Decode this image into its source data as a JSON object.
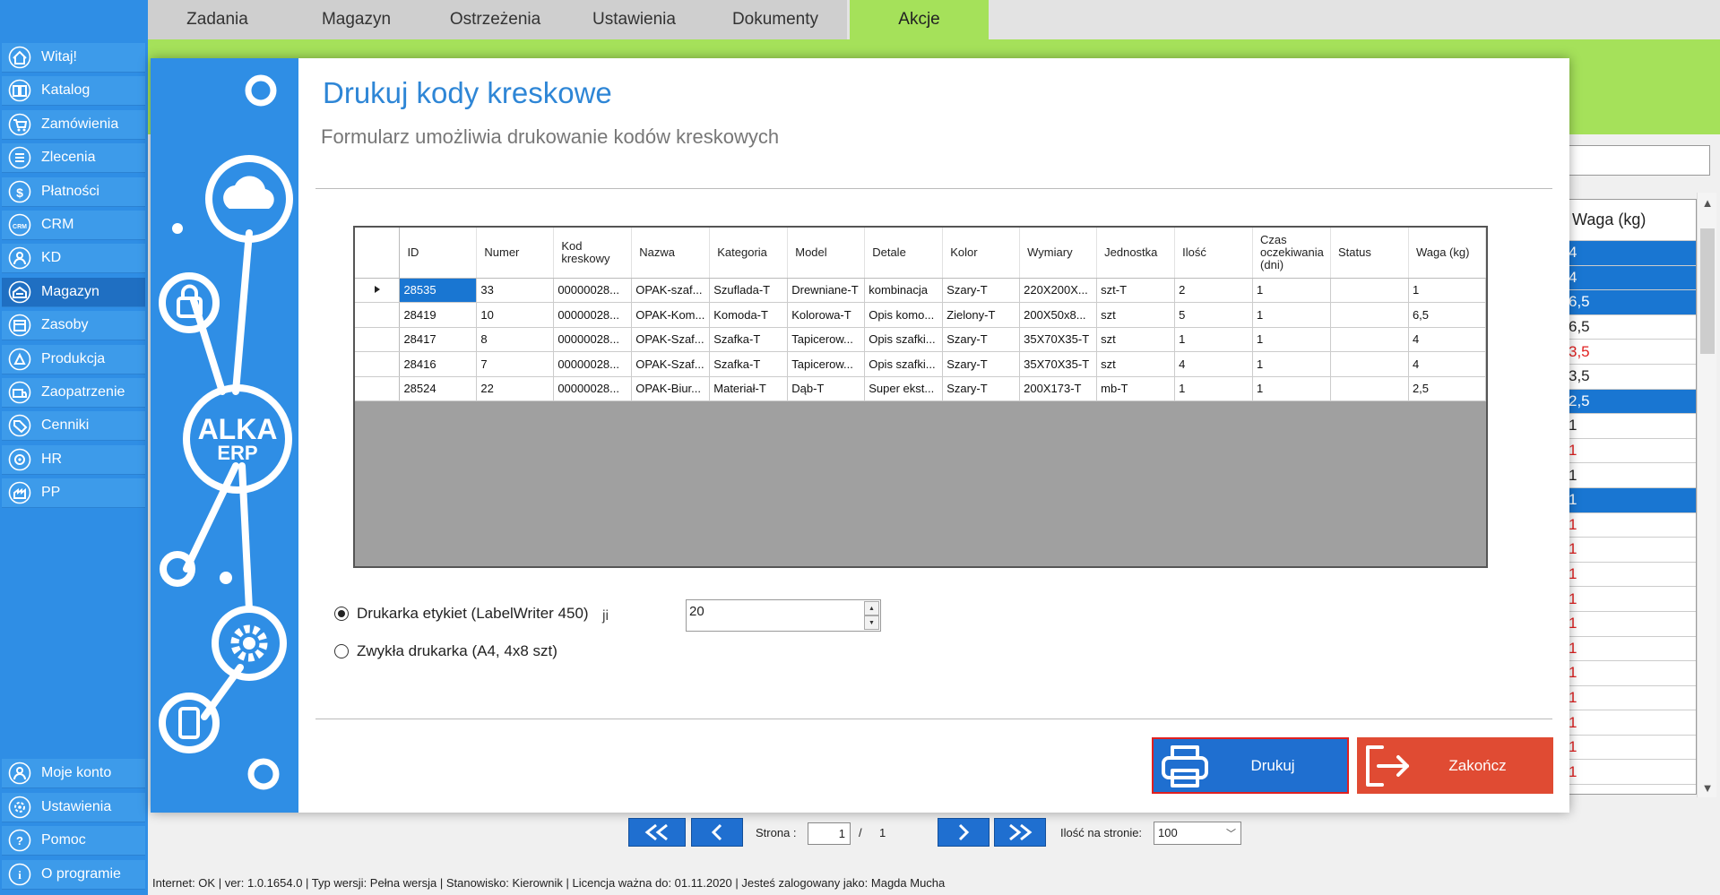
{
  "tabs": [
    {
      "label": "Zadania"
    },
    {
      "label": "Magazyn"
    },
    {
      "label": "Ostrzeżenia"
    },
    {
      "label": "Ustawienia"
    },
    {
      "label": "Dokumenty"
    },
    {
      "label": "Akcje",
      "active": true
    }
  ],
  "sidebar": {
    "items": [
      {
        "label": "Witaj!",
        "icon": "home-icon"
      },
      {
        "label": "Katalog",
        "icon": "book-icon"
      },
      {
        "label": "Zamówienia",
        "icon": "cart-icon"
      },
      {
        "label": "Zlecenia",
        "icon": "list-icon"
      },
      {
        "label": "Płatności",
        "icon": "dollar-icon"
      },
      {
        "label": "CRM",
        "icon": "crm-icon"
      },
      {
        "label": "KD",
        "icon": "person-icon"
      },
      {
        "label": "Magazyn",
        "icon": "warehouse-icon",
        "active": true
      },
      {
        "label": "Zasoby",
        "icon": "resources-icon"
      },
      {
        "label": "Produkcja",
        "icon": "production-icon"
      },
      {
        "label": "Zaopatrzenie",
        "icon": "supply-icon"
      },
      {
        "label": "Cenniki",
        "icon": "price-tag-icon"
      },
      {
        "label": "HR",
        "icon": "hr-icon"
      },
      {
        "label": "PP",
        "icon": "pp-icon"
      }
    ],
    "bottom": [
      {
        "label": "Moje konto",
        "icon": "account-icon"
      },
      {
        "label": "Ustawienia",
        "icon": "settings-icon"
      },
      {
        "label": "Pomoc",
        "icon": "help-icon"
      },
      {
        "label": "O programie",
        "icon": "info-icon"
      }
    ]
  },
  "background_grid": {
    "header": "Waga (kg)",
    "cells": [
      {
        "text": "4",
        "sel": true
      },
      {
        "text": "4",
        "sel": true
      },
      {
        "text": "6,5",
        "sel": true
      },
      {
        "text": "6,5"
      },
      {
        "text": "3,5",
        "red": true
      },
      {
        "text": "3,5"
      },
      {
        "text": "2,5",
        "sel": true
      },
      {
        "text": "1"
      },
      {
        "text": "1",
        "red": true
      },
      {
        "text": "1"
      },
      {
        "text": "1",
        "sel": true
      },
      {
        "text": "1",
        "red": true
      },
      {
        "text": "1",
        "red": true
      },
      {
        "text": "1",
        "red": true
      },
      {
        "text": "1",
        "red": true
      },
      {
        "text": "1",
        "red": true
      },
      {
        "text": "1",
        "red": true
      },
      {
        "text": "1",
        "red": true
      },
      {
        "text": "1",
        "red": true
      },
      {
        "text": "1",
        "red": true
      },
      {
        "text": "1",
        "red": true
      },
      {
        "text": "1",
        "red": true
      }
    ]
  },
  "modal": {
    "logo_line1": "ALKA",
    "logo_line2": "ERP",
    "title": "Drukuj kody kreskowe",
    "subtitle": "Formularz umożliwia drukowanie kodów kreskowych",
    "table": {
      "columns": [
        "ID",
        "Numer",
        "Kod kreskowy",
        "Nazwa",
        "Kategoria",
        "Model",
        "Detale",
        "Kolor",
        "Wymiary",
        "Jednostka",
        "Ilość",
        "Czas oczekiwania (dni)",
        "Status",
        "Waga (kg)"
      ],
      "rows": [
        [
          "28535",
          "33",
          "00000028...",
          "OPAK-szaf...",
          "Szuflada-T",
          "Drewniane-T",
          "kombinacja",
          "Szary-T",
          "220X200X...",
          "szt-T",
          "2",
          "1",
          "",
          "1"
        ],
        [
          "28419",
          "10",
          "00000028...",
          "OPAK-Kom...",
          "Komoda-T",
          "Kolorowa-T",
          "Opis komo...",
          "Zielony-T",
          "200X50x8...",
          "szt",
          "5",
          "1",
          "",
          "6,5"
        ],
        [
          "28417",
          "8",
          "00000028...",
          "OPAK-Szaf...",
          "Szafka-T",
          "Tapicerow...",
          "Opis szafki...",
          "Szary-T",
          "35X70X35-T",
          "szt",
          "1",
          "1",
          "",
          "4"
        ],
        [
          "28416",
          "7",
          "00000028...",
          "OPAK-Szaf...",
          "Szafka-T",
          "Tapicerow...",
          "Opis szafki...",
          "Szary-T",
          "35X70X35-T",
          "szt",
          "4",
          "1",
          "",
          "4"
        ],
        [
          "28524",
          "22",
          "00000028...",
          "OPAK-Biur...",
          "Materiał-T",
          "Dąb-T",
          "Super ekst...",
          "Szary-T",
          "200X173-T",
          "mb-T",
          "1",
          "1",
          "",
          "2,5"
        ]
      ]
    },
    "options": {
      "label_printer": "Drukarka etykiet (LabelWriter 450)",
      "label_printer_suffix": "ji",
      "normal_printer": "Zwykła drukarka (A4, 4x8 szt)",
      "copies_value": "20"
    },
    "print_label": "Drukuj",
    "close_label": "Zakończ"
  },
  "pager": {
    "page_label": "Strona :",
    "current_page": "1",
    "separator": "/",
    "total_pages": "1",
    "per_page_label": "Ilość na stronie:",
    "per_page_value": "100"
  },
  "statusbar": {
    "text": "Internet: OK  |   ver: 1.0.1654.0   |   Typ wersji: Pełna wersja   |   Stanowisko: Kierownik   |   Licencja ważna do: 01.11.2020   |   Jesteś zalogowany jako: Magda Mucha"
  },
  "colors": {
    "sidebar": "#2f8ee5",
    "accent_green": "#a5e15a",
    "print_button": "#1f6fd0",
    "close_button": "#e04b33",
    "selection": "#1976d2"
  }
}
